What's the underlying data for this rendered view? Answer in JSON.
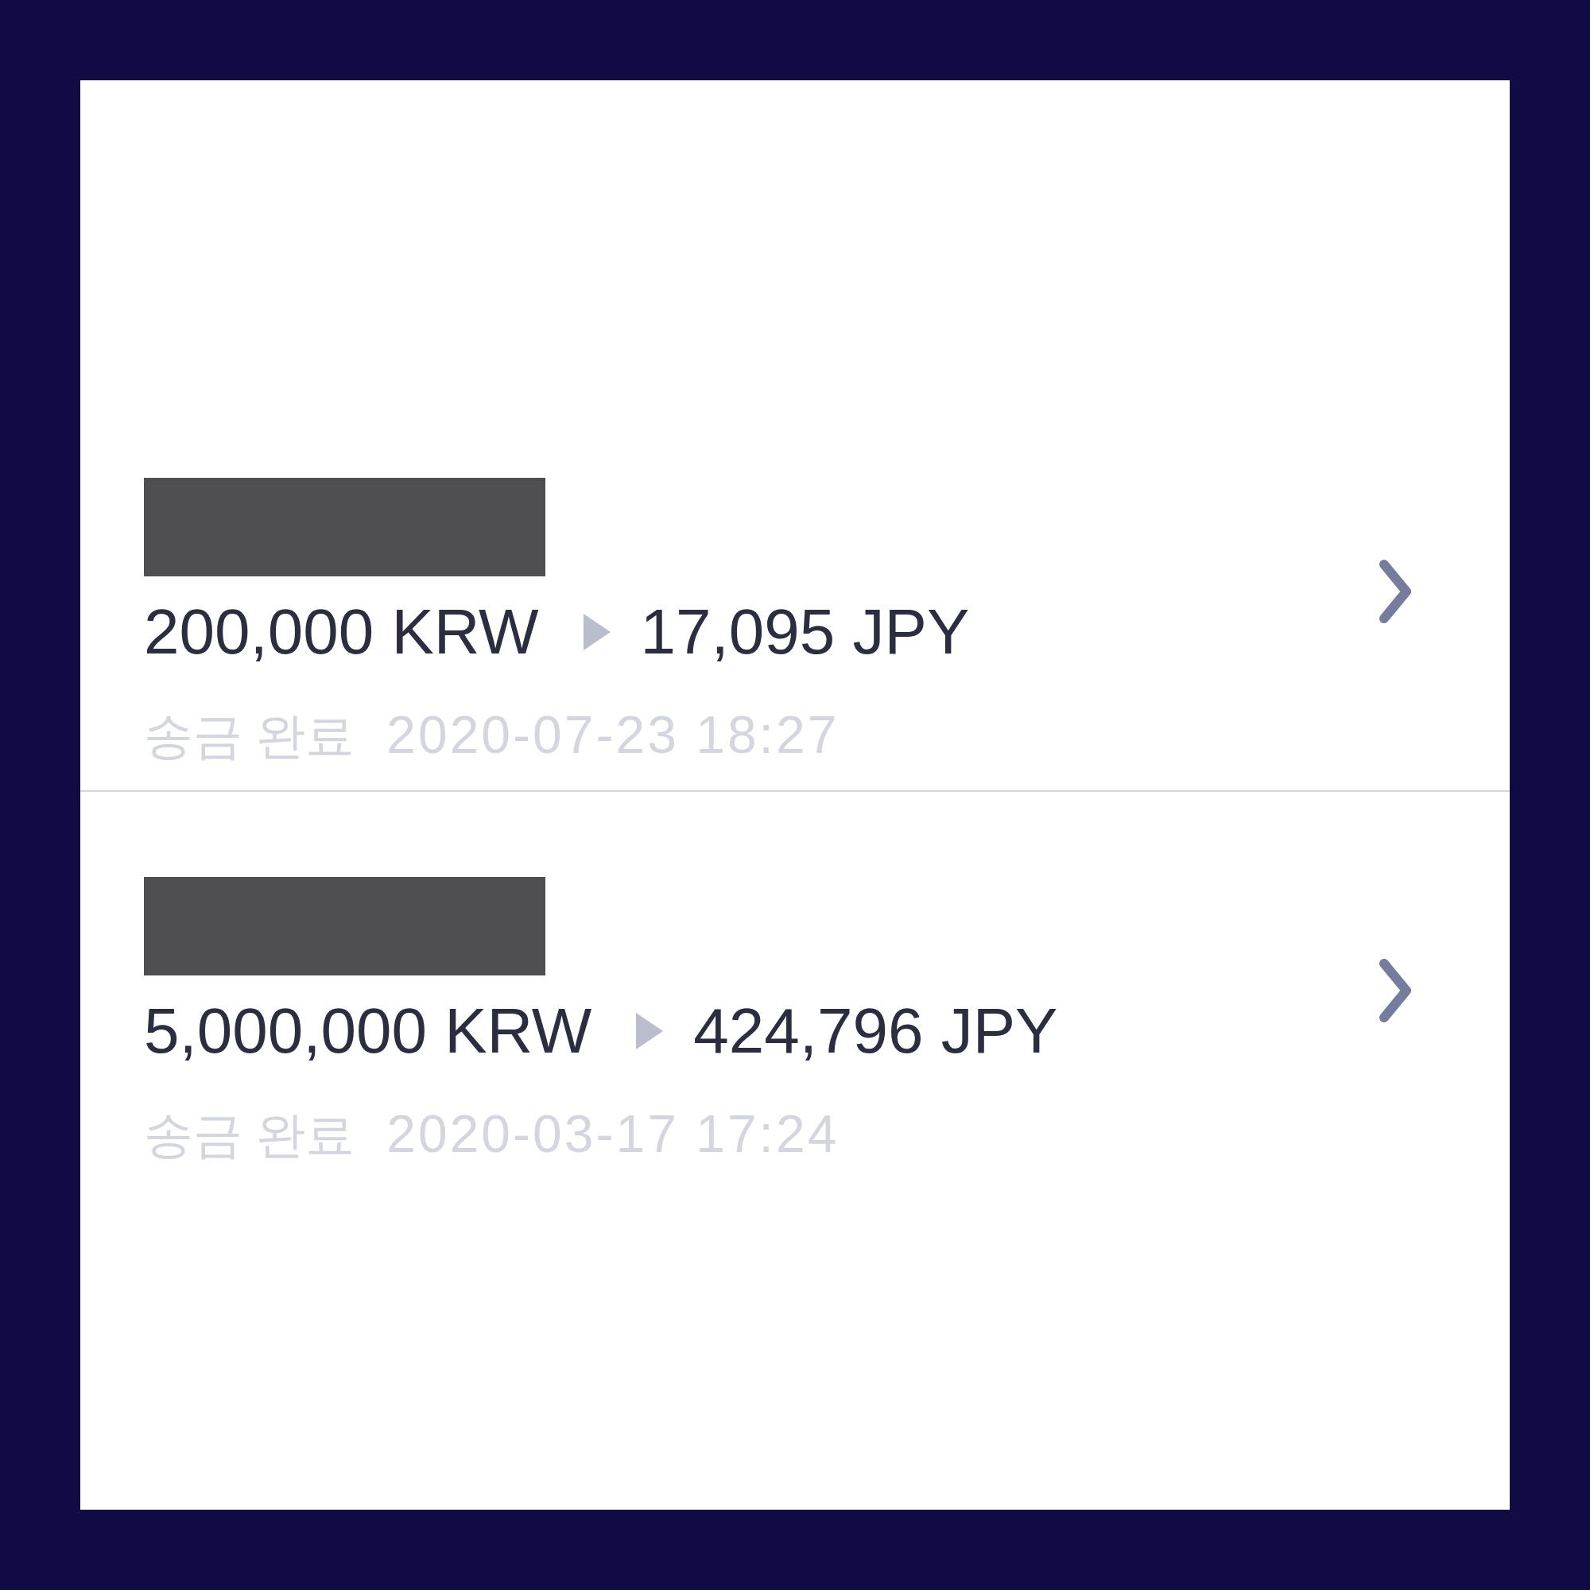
{
  "transfers": [
    {
      "redacted": true,
      "send_amount": "200,000 KRW",
      "receive_amount": "17,095 JPY",
      "status": "송금 완료",
      "datetime": "2020-07-23 18:27"
    },
    {
      "redacted": true,
      "send_amount": "5,000,000 KRW",
      "receive_amount": "424,796 JPY",
      "status": "송금 완료",
      "datetime": "2020-03-17 17:24"
    }
  ]
}
